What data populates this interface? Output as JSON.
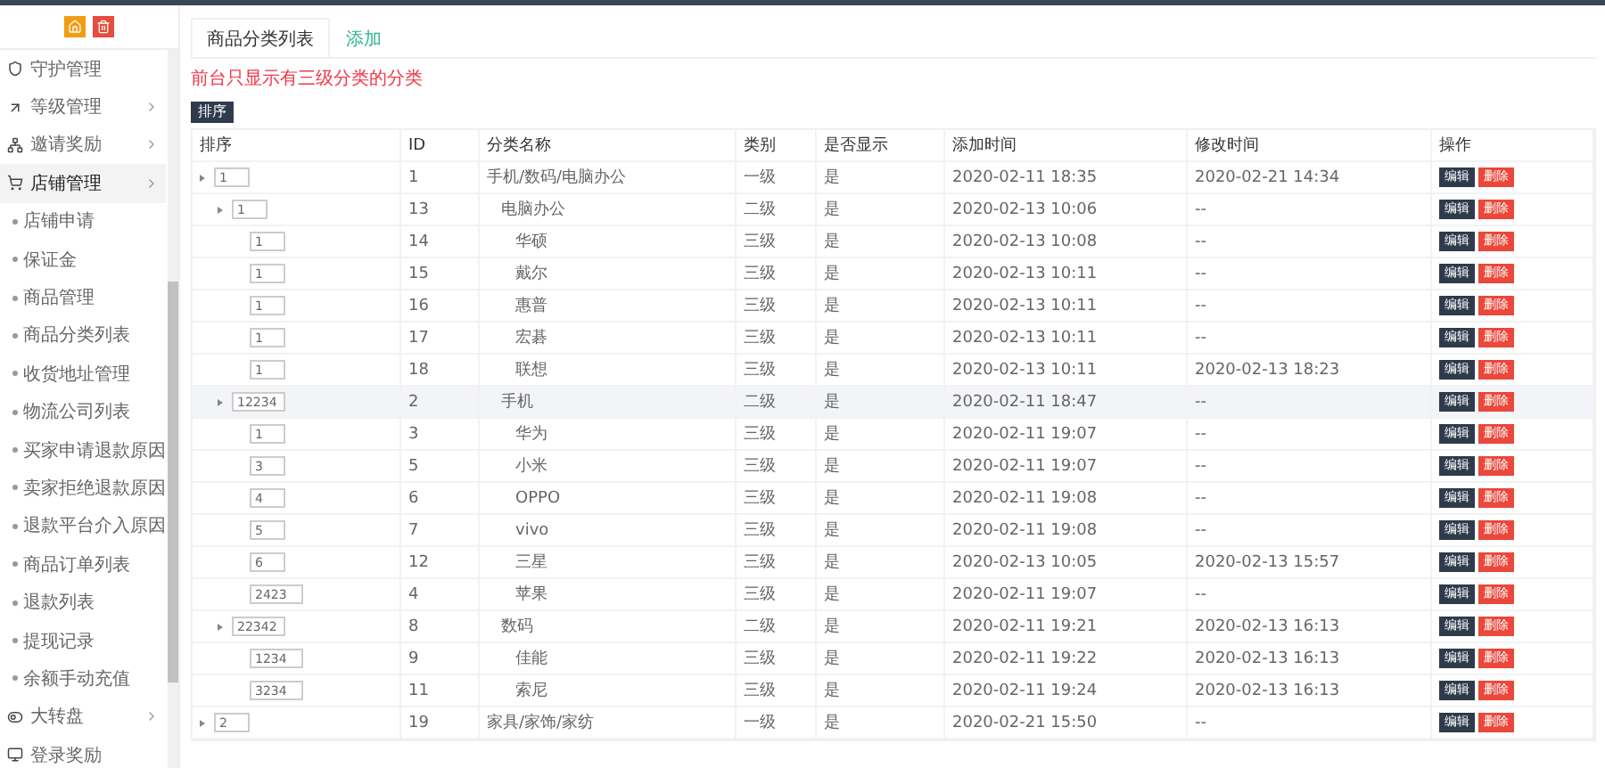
{
  "sidebar": {
    "items": [
      {
        "label": "守护管理"
      },
      {
        "label": "等级管理",
        "expanded": false
      },
      {
        "label": "邀请奖励",
        "expanded": false
      },
      {
        "label": "店铺管理",
        "expanded": true,
        "children": [
          {
            "label": "店铺申请"
          },
          {
            "label": "保证金"
          },
          {
            "label": "商品管理"
          },
          {
            "label": "商品分类列表"
          },
          {
            "label": "收货地址管理"
          },
          {
            "label": "物流公司列表"
          },
          {
            "label": "买家申请退款原因"
          },
          {
            "label": "卖家拒绝退款原因"
          },
          {
            "label": "退款平台介入原因"
          },
          {
            "label": "商品订单列表"
          },
          {
            "label": "退款列表"
          },
          {
            "label": "提现记录"
          },
          {
            "label": "余额手动充值"
          }
        ]
      },
      {
        "label": "大转盘",
        "expanded": false
      },
      {
        "label": "登录奖励"
      }
    ]
  },
  "tabs": [
    {
      "label": "商品分类列表",
      "selected": true
    },
    {
      "label": "添加",
      "selected": false
    }
  ],
  "notice": "前台只显示有三级分类的分类",
  "sort_button": "排序",
  "table": {
    "columns": [
      "排序",
      "ID",
      "分类名称",
      "类别",
      "是否显示",
      "添加时间",
      "修改时间",
      "操作"
    ],
    "rows": [
      {
        "sort": "1",
        "id": "1",
        "name": "手机/数码/电脑办公",
        "tier": "一级",
        "shown": "是",
        "added": "2020-02-11 18:35",
        "modified": "2020-02-21 14:34",
        "actions": [
          "编辑",
          "删除"
        ],
        "toggle": true,
        "highlighted": false,
        "children": [
          {
            "sort": "1",
            "id": "13",
            "name": "电脑办公",
            "tier": "二级",
            "shown": "是",
            "added": "2020-02-13 10:06",
            "modified": "--",
            "actions": [
              "编辑",
              "删除"
            ],
            "toggle": true,
            "highlighted": false,
            "children": [
              {
                "sort": "1",
                "id": "14",
                "name": "华硕",
                "tier": "三级",
                "shown": "是",
                "added": "2020-02-13 10:08",
                "modified": "--",
                "actions": [
                  "编辑",
                  "删除"
                ],
                "toggle": false,
                "highlighted": false
              },
              {
                "sort": "1",
                "id": "15",
                "name": "戴尔",
                "tier": "三级",
                "shown": "是",
                "added": "2020-02-13 10:11",
                "modified": "--",
                "actions": [
                  "编辑",
                  "删除"
                ],
                "toggle": false,
                "highlighted": false
              },
              {
                "sort": "1",
                "id": "16",
                "name": "惠普",
                "tier": "三级",
                "shown": "是",
                "added": "2020-02-13 10:11",
                "modified": "--",
                "actions": [
                  "编辑",
                  "删除"
                ],
                "toggle": false,
                "highlighted": false
              },
              {
                "sort": "1",
                "id": "17",
                "name": "宏碁",
                "tier": "三级",
                "shown": "是",
                "added": "2020-02-13 10:11",
                "modified": "--",
                "actions": [
                  "编辑",
                  "删除"
                ],
                "toggle": false,
                "highlighted": false
              },
              {
                "sort": "1",
                "id": "18",
                "name": "联想",
                "tier": "三级",
                "shown": "是",
                "added": "2020-02-13 10:11",
                "modified": "2020-02-13 18:23",
                "actions": [
                  "编辑",
                  "删除"
                ],
                "toggle": false,
                "highlighted": false
              }
            ]
          },
          {
            "sort": "12234",
            "id": "2",
            "name": "手机",
            "tier": "二级",
            "shown": "是",
            "added": "2020-02-11 18:47",
            "modified": "--",
            "actions": [
              "编辑",
              "删除"
            ],
            "toggle": true,
            "highlighted": true,
            "children": [
              {
                "sort": "1",
                "id": "3",
                "name": "华为",
                "tier": "三级",
                "shown": "是",
                "added": "2020-02-11 19:07",
                "modified": "--",
                "actions": [
                  "编辑",
                  "删除"
                ],
                "toggle": false,
                "highlighted": false
              },
              {
                "sort": "3",
                "id": "5",
                "name": "小米",
                "tier": "三级",
                "shown": "是",
                "added": "2020-02-11 19:07",
                "modified": "--",
                "actions": [
                  "编辑",
                  "删除"
                ],
                "toggle": false,
                "highlighted": false
              },
              {
                "sort": "4",
                "id": "6",
                "name": "OPPO",
                "tier": "三级",
                "shown": "是",
                "added": "2020-02-11 19:08",
                "modified": "--",
                "actions": [
                  "编辑",
                  "删除"
                ],
                "toggle": false,
                "highlighted": false
              },
              {
                "sort": "5",
                "id": "7",
                "name": "vivo",
                "tier": "三级",
                "shown": "是",
                "added": "2020-02-11 19:08",
                "modified": "--",
                "actions": [
                  "编辑",
                  "删除"
                ],
                "toggle": false,
                "highlighted": false
              },
              {
                "sort": "6",
                "id": "12",
                "name": "三星",
                "tier": "三级",
                "shown": "是",
                "added": "2020-02-13 10:05",
                "modified": "2020-02-13 15:57",
                "actions": [
                  "编辑",
                  "删除"
                ],
                "toggle": false,
                "highlighted": false
              },
              {
                "sort": "2423",
                "id": "4",
                "name": "苹果",
                "tier": "三级",
                "shown": "是",
                "added": "2020-02-11 19:07",
                "modified": "--",
                "actions": [
                  "编辑",
                  "删除"
                ],
                "toggle": false,
                "highlighted": false
              }
            ]
          },
          {
            "sort": "22342",
            "id": "8",
            "name": "数码",
            "tier": "二级",
            "shown": "是",
            "added": "2020-02-11 19:21",
            "modified": "2020-02-13 16:13",
            "actions": [
              "编辑",
              "删除"
            ],
            "toggle": true,
            "highlighted": false,
            "children": [
              {
                "sort": "1234",
                "id": "9",
                "name": "佳能",
                "tier": "三级",
                "shown": "是",
                "added": "2020-02-11 19:22",
                "modified": "2020-02-13 16:13",
                "actions": [
                  "编辑",
                  "删除"
                ],
                "toggle": false,
                "highlighted": false
              },
              {
                "sort": "3234",
                "id": "11",
                "name": "索尼",
                "tier": "三级",
                "shown": "是",
                "added": "2020-02-11 19:24",
                "modified": "2020-02-13 16:13",
                "actions": [
                  "编辑",
                  "删除"
                ],
                "toggle": false,
                "highlighted": false
              }
            ]
          }
        ]
      },
      {
        "sort": "2",
        "id": "19",
        "name": "家具/家饰/家纺",
        "tier": "一级",
        "shown": "是",
        "added": "2020-02-21 15:50",
        "modified": "--",
        "actions": [
          "编辑",
          "删除"
        ],
        "toggle": true,
        "highlighted": false
      }
    ]
  }
}
